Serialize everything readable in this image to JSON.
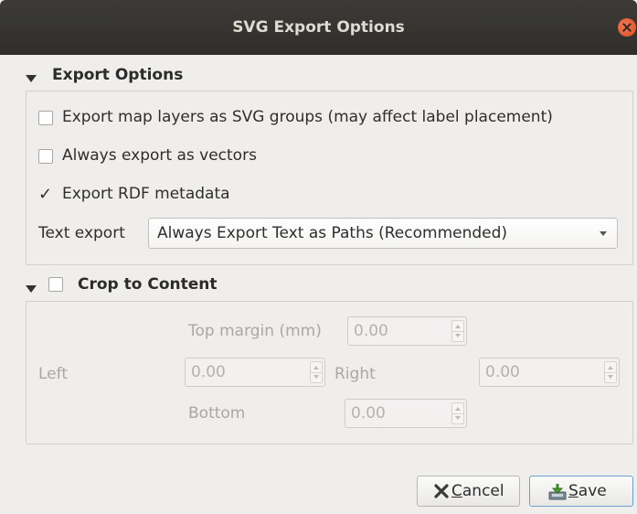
{
  "window": {
    "title": "SVG Export Options"
  },
  "export_options": {
    "title": "Export Options",
    "checkboxes": [
      {
        "label": "Export map layers as SVG groups (may affect label placement)",
        "checked": false
      },
      {
        "label": "Always export as vectors",
        "checked": false
      },
      {
        "label": "Export RDF metadata",
        "checked": true
      }
    ],
    "text_export": {
      "label": "Text export",
      "value": "Always Export Text as Paths (Recommended)"
    }
  },
  "crop": {
    "title": "Crop to Content",
    "checked": false,
    "top_label": "Top margin (mm)",
    "top_value": "0.00",
    "left_label": "Left",
    "left_value": "0.00",
    "right_label": "Right",
    "right_value": "0.00",
    "bottom_label": "Bottom",
    "bottom_value": "0.00"
  },
  "buttons": {
    "cancel_label": "Cancel",
    "cancel_mnemonic": "C",
    "cancel_rest": "ancel",
    "save_label": "Save",
    "save_mnemonic": "S",
    "save_rest": "ave"
  },
  "colors": {
    "titlebar": "#3c3b37",
    "close": "#e95420",
    "dialog_bg": "#efeeec"
  }
}
